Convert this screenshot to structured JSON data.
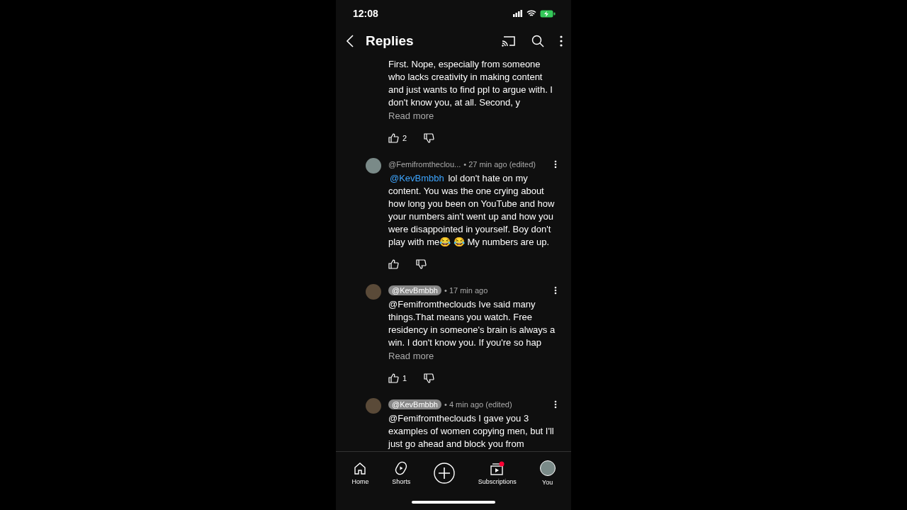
{
  "status_bar": {
    "time": "12:08"
  },
  "header": {
    "title": "Replies"
  },
  "comments": [
    {
      "text": "First. Nope, especially from someone who lacks creativity in making content and just wants to find ppl to argue with. I don't know you, at all. Second, y",
      "read_more": "Read more",
      "likes": "2"
    },
    {
      "author": "@Femifromtheclou...",
      "creator": false,
      "time": "• 27 min ago (edited)",
      "mention_link": "@KevBmbbh",
      "text": "lol don't hate on my content. You was the one crying about how long you been on YouTube and how your numbers ain't went up and how you were disappointed in yourself. Boy don't play with me😂 😂 My numbers are up."
    },
    {
      "author": "@KevBmbbh",
      "creator": true,
      "time": "• 17 min ago",
      "text": "@Femifromtheclouds Ive said many things.That means you watch. Free residency in someone's brain is always a win. I don't know you. If you're so hap",
      "read_more": "Read more",
      "likes": "1"
    },
    {
      "author": "@KevBmbbh",
      "creator": true,
      "time": "• 4 min ago (edited)",
      "text": "@Femifromtheclouds  I gave you 3 examples of women copying men, but I'll just go ahead and block you from"
    }
  ],
  "nav": [
    {
      "kind": "home",
      "label": "Home"
    },
    {
      "kind": "shorts",
      "label": "Shorts"
    },
    {
      "kind": "create"
    },
    {
      "kind": "subscriptions",
      "label": "Subscriptions",
      "badge": true
    },
    {
      "kind": "you",
      "label": "You"
    }
  ]
}
